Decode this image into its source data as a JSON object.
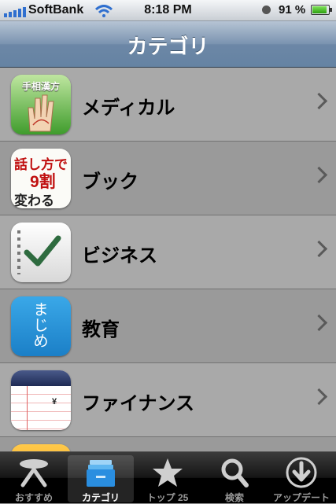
{
  "status": {
    "carrier": "SoftBank",
    "time": "8:18 PM",
    "battery": "91 %"
  },
  "navbar": {
    "title": "カテゴリ"
  },
  "categories": [
    {
      "label": "メディカル",
      "icon_text": "手相漢方",
      "icon": "palm-icon"
    },
    {
      "label": "ブック",
      "icon_text_1": "話し方で",
      "icon_text_2": "9割",
      "icon_text_3": "変わる",
      "icon": "book-icon"
    },
    {
      "label": "ビジネス",
      "icon": "checkmark-notebook-icon"
    },
    {
      "label": "教育",
      "icon_text": "まじめ",
      "icon": "education-icon"
    },
    {
      "label": "ファイナンス",
      "icon_text": "¥",
      "icon": "ledger-icon"
    }
  ],
  "tabs": [
    {
      "label": "おすすめ",
      "icon": "featured-icon"
    },
    {
      "label": "カテゴリ",
      "icon": "categories-icon",
      "active": true
    },
    {
      "label": "トップ 25",
      "icon": "star-icon"
    },
    {
      "label": "検索",
      "icon": "search-icon"
    },
    {
      "label": "アップデート",
      "icon": "download-icon"
    }
  ],
  "colors": {
    "navbar": "#6c87a6",
    "row_light": "#a9a9a9",
    "row_dark": "#9a9a9a",
    "battery": "#2ea010"
  }
}
